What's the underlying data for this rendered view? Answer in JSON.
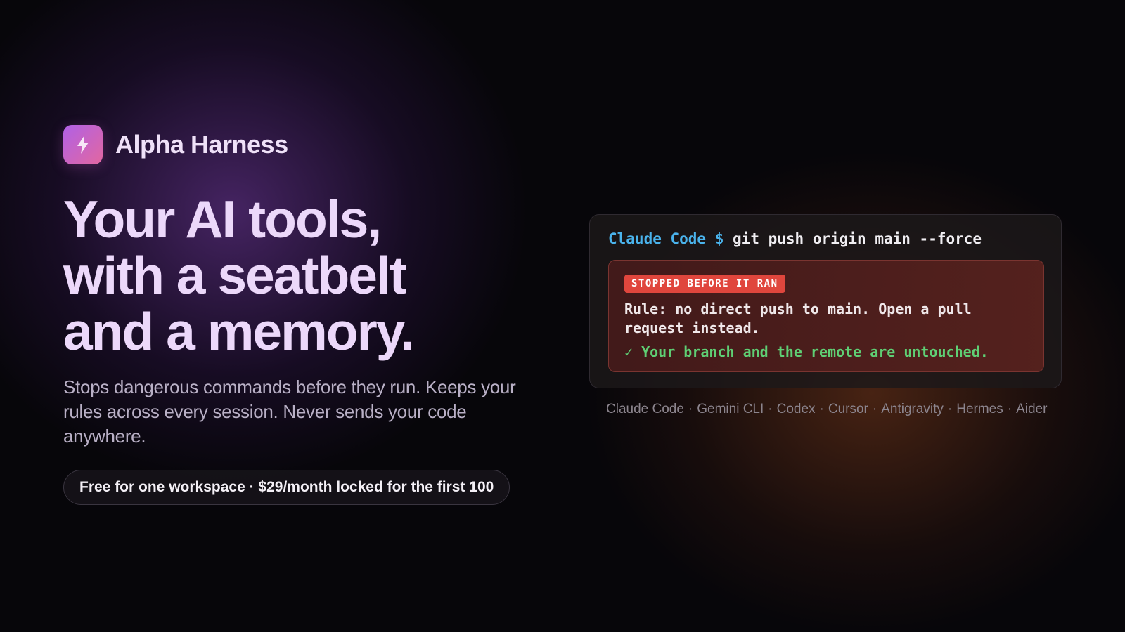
{
  "brand": {
    "name": "Alpha Harness",
    "logo_icon": "lightning-bolt-icon"
  },
  "hero": {
    "headline_lines": [
      "Your AI tools,",
      "with a seatbelt",
      "and a memory."
    ],
    "subtitle": "Stops dangerous commands before they run. Keeps your rules across every session. Never sends your code anywhere.",
    "pricing_pill": "Free for one workspace · $29/month locked for the first 100"
  },
  "terminal": {
    "agent": "Claude Code",
    "prompt": "$",
    "command": "git push origin main --force",
    "alert": {
      "badge": "STOPPED BEFORE IT RAN",
      "rule": "Rule: no direct push to main. Open a pull request instead.",
      "result": "✓ Your branch and the remote are untouched."
    }
  },
  "supported_tools": [
    "Claude Code",
    "Gemini CLI",
    "Codex",
    "Cursor",
    "Antigravity",
    "Hermes",
    "Aider"
  ],
  "tools_separator": "·",
  "colors": {
    "accent_purple": "#ecd8fa",
    "logo_gradient_start": "#b061e6",
    "logo_gradient_end": "#e267a0",
    "terminal_blue": "#4ab3ec",
    "alert_red": "#e0463d",
    "success_green": "#5fcf74"
  }
}
